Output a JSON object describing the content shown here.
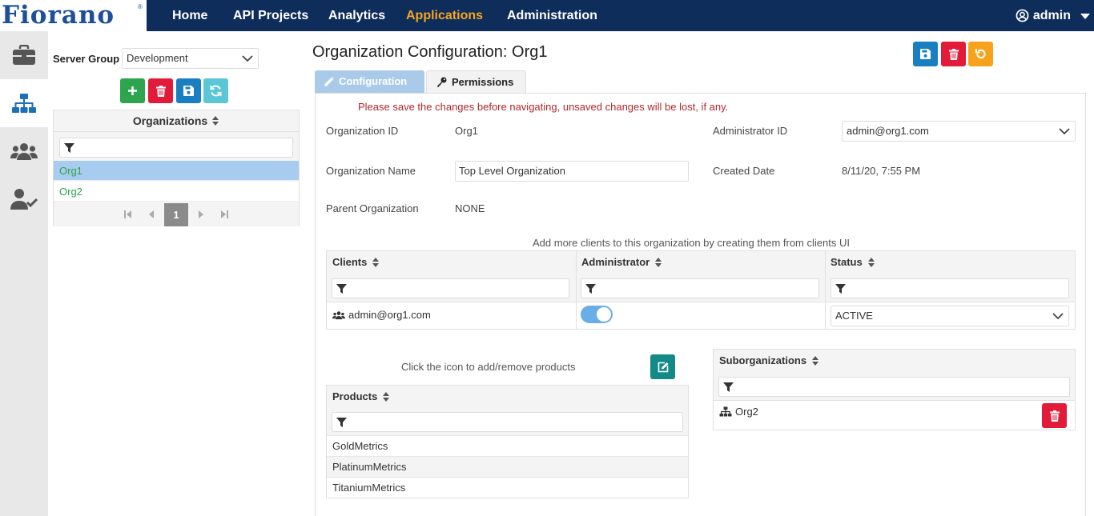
{
  "header": {
    "logo": "Fiorano",
    "logo_mark": "®",
    "nav": [
      {
        "label": "Home"
      },
      {
        "label": "API Projects"
      },
      {
        "label": "Analytics"
      },
      {
        "label": "Applications",
        "active": true
      },
      {
        "label": "Administration"
      }
    ],
    "user": "admin",
    "colors": {
      "bar": "#0f2d5a",
      "active": "#f5a623"
    }
  },
  "rail": {
    "items": [
      {
        "icon": "briefcase-icon"
      },
      {
        "icon": "sitemap-icon",
        "active": true
      },
      {
        "icon": "users-icon"
      },
      {
        "icon": "user-check-icon"
      }
    ]
  },
  "left": {
    "server_group_label": "Server Group",
    "server_group_value": "Development",
    "toolbar": [
      "plus-icon",
      "trash-icon",
      "save-icon",
      "refresh-icon"
    ],
    "organizations_header": "Organizations",
    "organizations": [
      {
        "name": "Org1",
        "selected": true
      },
      {
        "name": "Org2",
        "selected": false
      }
    ],
    "pager": {
      "current": "1"
    }
  },
  "main": {
    "title": "Organization Configuration: Org1",
    "actions": [
      "save-icon",
      "trash-icon",
      "undo-icon"
    ],
    "tabs": [
      {
        "label": "Configuration",
        "icon": "pencil-icon",
        "active": true
      },
      {
        "label": "Permissions",
        "icon": "key-icon",
        "active": false
      }
    ],
    "warning": "Please save the changes before navigating, unsaved changes will be lost, if any.",
    "fields": {
      "org_id_label": "Organization ID",
      "org_id_value": "Org1",
      "admin_id_label": "Administrator ID",
      "admin_id_value": "admin@org1.com",
      "org_name_label": "Organization Name",
      "org_name_value": "Top Level Organization",
      "created_label": "Created Date",
      "created_value": "8/11/20, 7:55 PM",
      "parent_label": "Parent Organization",
      "parent_value": "NONE"
    },
    "clients": {
      "note": "Add more clients to this organization by creating them from clients UI",
      "headers": [
        "Clients",
        "Administrator",
        "Status"
      ],
      "rows": [
        {
          "client": "admin@org1.com",
          "administrator": true,
          "status": "ACTIVE"
        }
      ]
    },
    "products": {
      "note": "Click the icon to add/remove products",
      "header": "Products",
      "items": [
        "GoldMetrics",
        "PlatinumMetrics",
        "TitaniumMetrics"
      ]
    },
    "suborganizations": {
      "header": "Suborganizations",
      "items": [
        "Org2"
      ]
    }
  }
}
